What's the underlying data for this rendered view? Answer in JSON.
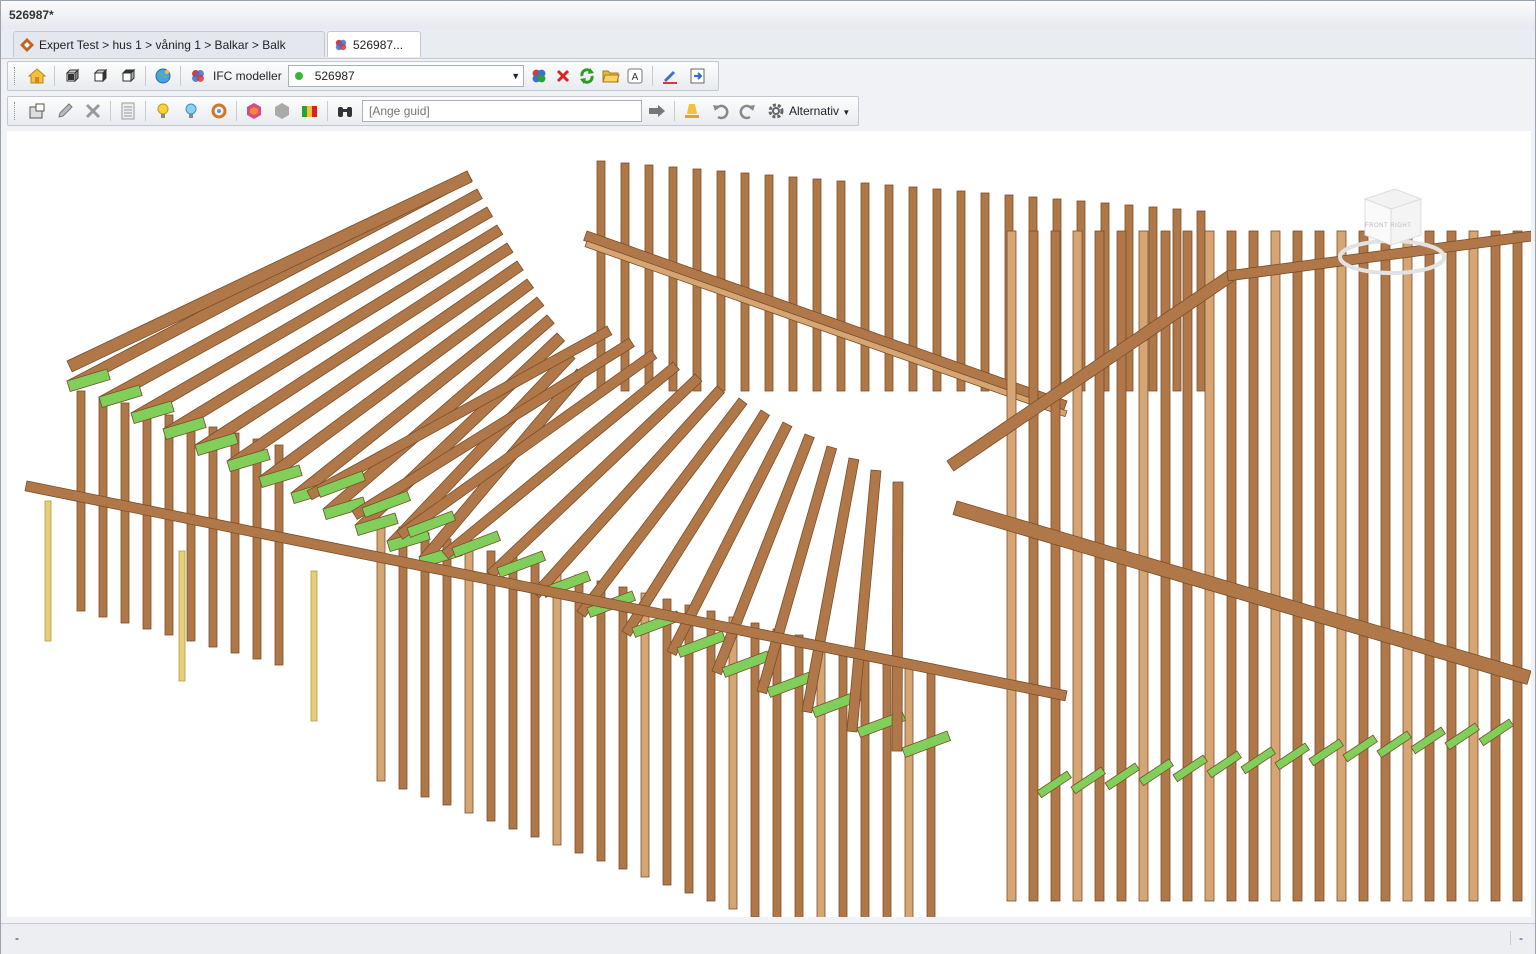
{
  "window": {
    "title": "526987*"
  },
  "tabs": [
    {
      "label": "Expert Test > hus 1 > våning 1 > Balkar > Balk"
    },
    {
      "label": "526987..."
    }
  ],
  "toolbar1": {
    "ifc_label": "IFC modeller",
    "model_value": "526987",
    "icons": [
      "home-icon",
      "cube-front-icon",
      "cube-side-icon",
      "cube-top-icon",
      "globe-icon",
      "ifc-logo-icon",
      "add-model-icon",
      "delete-icon",
      "refresh-icon",
      "folder-open-icon",
      "text-a-icon",
      "edit-pen-icon",
      "export-icon"
    ]
  },
  "toolbar2": {
    "guid_placeholder": "[Ange guid]",
    "alternativ_label": "Alternativ",
    "icons": [
      "properties-icon",
      "pencil-icon",
      "tools-icon",
      "list-icon",
      "bulb-yellow-icon",
      "bulb-blue-icon",
      "orbit-icon",
      "color-hex-icon",
      "gray-hex-icon",
      "color-bars-icon",
      "binoculars-icon",
      "go-arrow-icon",
      "highlight-icon",
      "undo-icon",
      "redo-icon",
      "gear-icon"
    ]
  },
  "viewport": {
    "navcube_label": "FRONT RIGHT",
    "colors": {
      "timber": "#b07848",
      "timber_dark": "#7a4e2a",
      "timber_light": "#d6a574",
      "plate_green": "#7fcf5a",
      "post_light": "#e6cf7a"
    }
  },
  "status": {
    "left": "-",
    "right": "-"
  }
}
